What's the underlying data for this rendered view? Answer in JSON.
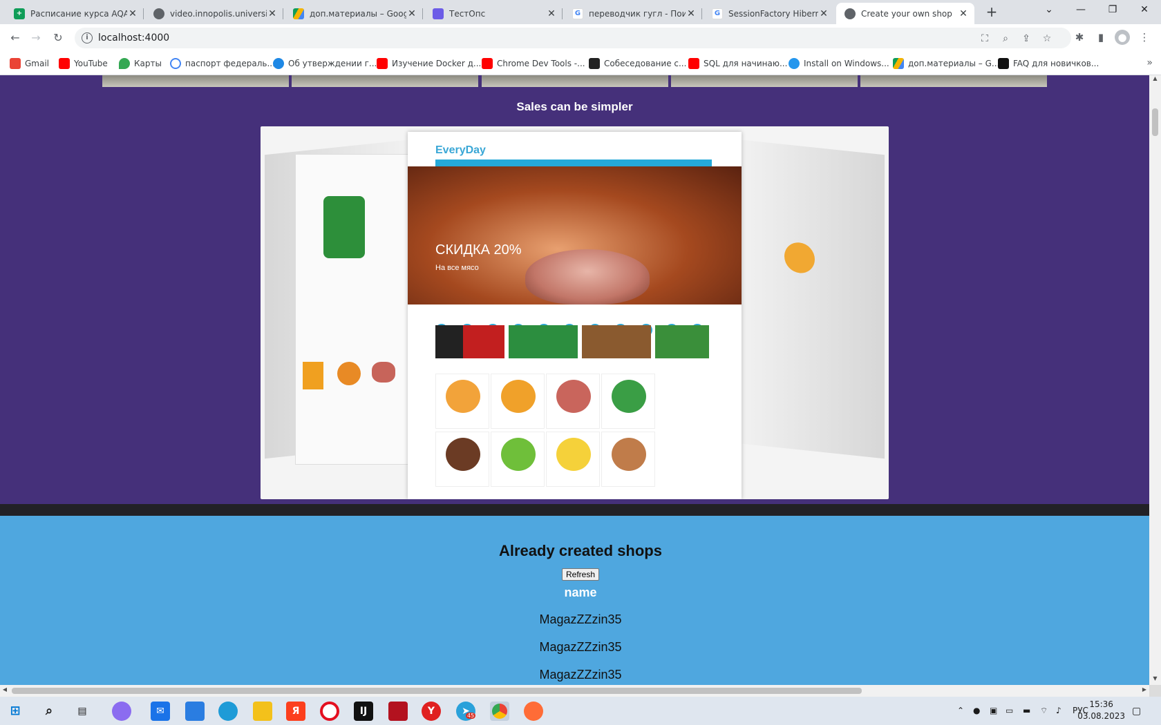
{
  "browser": {
    "tabs": [
      {
        "title": "Расписание курса AQA Ja",
        "icon": "sheets-icon",
        "color": "#0f9d58"
      },
      {
        "title": "video.innopolis.university",
        "icon": "globe-icon",
        "color": "#5f6368"
      },
      {
        "title": "доп.материалы – Google",
        "icon": "drive-icon",
        "color": "#f4b400"
      },
      {
        "title": "ТестОпс",
        "icon": "testops-icon",
        "color": "#6c5ce7"
      },
      {
        "title": "переводчик гугл - Поиск",
        "icon": "google-icon",
        "color": "#4285f4"
      },
      {
        "title": "SessionFactory Hibernate",
        "icon": "google-icon",
        "color": "#4285f4"
      },
      {
        "title": "Create your own shop",
        "icon": "globe-icon",
        "color": "#5f6368",
        "active": true
      }
    ],
    "url": "localhost:4000",
    "bookmarks": [
      {
        "label": "Gmail",
        "icon": "gmail-icon",
        "color": "#ea4335"
      },
      {
        "label": "YouTube",
        "icon": "youtube-icon",
        "color": "#ff0000"
      },
      {
        "label": "Карты",
        "icon": "maps-icon",
        "color": "#34a853"
      },
      {
        "label": "паспорт федераль...",
        "icon": "google-icon",
        "color": "#4285f4"
      },
      {
        "label": "Об утверждении г...",
        "icon": "edit-icon",
        "color": "#1e88e5"
      },
      {
        "label": "Изучение Docker д...",
        "icon": "youtube-icon",
        "color": "#ff0000"
      },
      {
        "label": "Chrome Dev Tools -...",
        "icon": "youtube-icon",
        "color": "#ff0000"
      },
      {
        "label": "Собеседование с...",
        "icon": "it-icon",
        "color": "#222222"
      },
      {
        "label": "SQL для начинаю...",
        "icon": "youtube-icon",
        "color": "#ff0000"
      },
      {
        "label": "Install on Windows...",
        "icon": "docker-icon",
        "color": "#2496ed"
      },
      {
        "label": "доп.материалы – G...",
        "icon": "drive-icon",
        "color": "#f4b400"
      },
      {
        "label": "FAQ для новичков...",
        "icon": "faq-icon",
        "color": "#111111"
      }
    ]
  },
  "page": {
    "section_title": "Sales can be simpler",
    "hero_image": {
      "logo": "EveryDay",
      "banner_text": "СКИДКА 20%",
      "banner_subtext": "На все мясо"
    },
    "shops": {
      "title": "Already created shops",
      "refresh_label": "Refresh",
      "column_header": "name",
      "rows": [
        "MagazZZzin35",
        "MagazZZzin35",
        "MagazZZzin35"
      ]
    }
  },
  "taskbar": {
    "apps": [
      {
        "name": "start-icon"
      },
      {
        "name": "search-icon"
      },
      {
        "name": "task-view-icon"
      },
      {
        "name": "alice-icon"
      },
      {
        "name": "mail-icon"
      },
      {
        "name": "store-icon"
      },
      {
        "name": "edge-icon"
      },
      {
        "name": "explorer-icon"
      },
      {
        "name": "yandex-icon"
      },
      {
        "name": "opera-icon"
      },
      {
        "name": "intellij-icon"
      },
      {
        "name": "pdf-icon"
      },
      {
        "name": "yandex-browser-icon"
      },
      {
        "name": "telegram-icon"
      },
      {
        "name": "chrome-icon"
      },
      {
        "name": "postman-icon"
      }
    ],
    "telegram_badge": "45",
    "language": "РУС",
    "time": "15:36",
    "date": "03.08.2023"
  },
  "colors": {
    "purple_bg": "#45307a",
    "blue_bg": "#4fa7df",
    "dark_bar": "#222126"
  }
}
